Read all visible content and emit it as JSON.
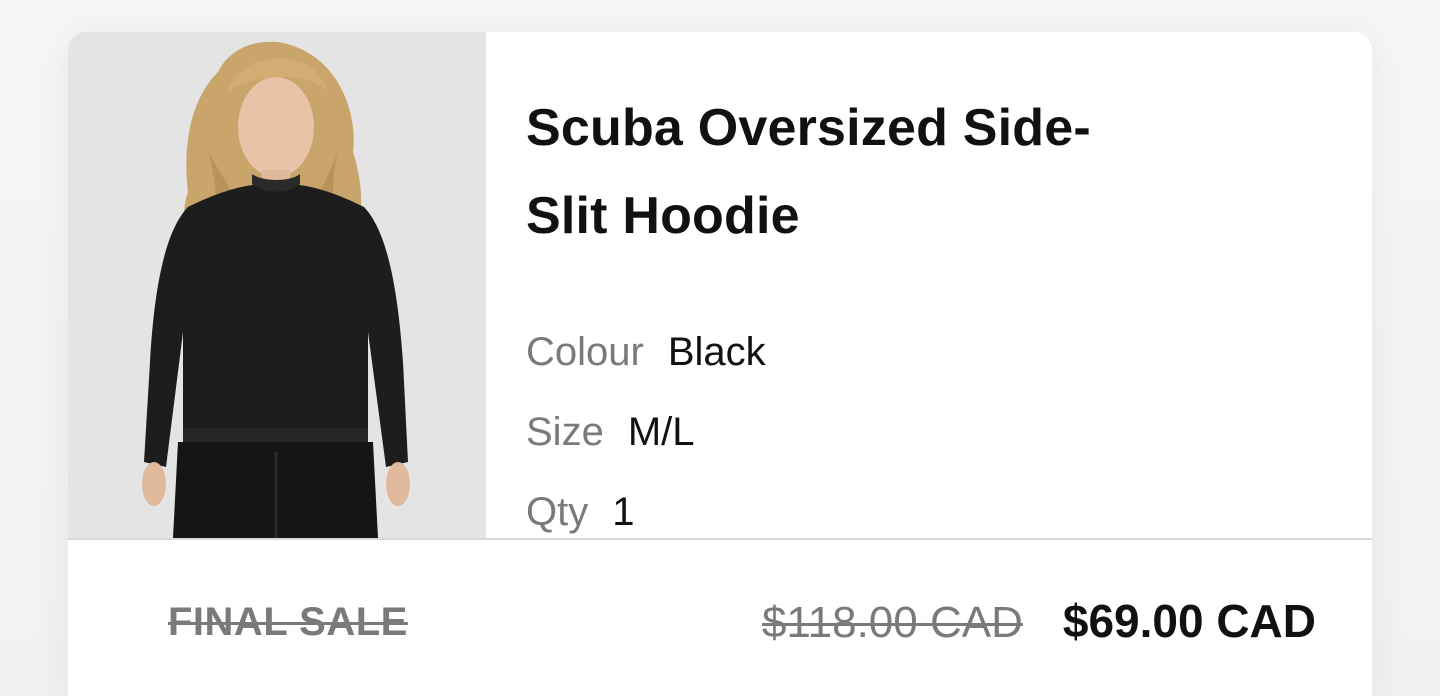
{
  "product": {
    "title": "Scuba Oversized Side-Slit Hoodie",
    "image_alt": "woman wearing black hoodie"
  },
  "attributes": [
    {
      "label": "Colour",
      "value": "Black"
    },
    {
      "label": "Size",
      "value": "M/L"
    },
    {
      "label": "Qty",
      "value": "1"
    }
  ],
  "pricing": {
    "final_sale_label": "FINAL SALE",
    "original_price": "$118.00 CAD",
    "sale_price": "$69.00 CAD"
  },
  "colors": {
    "text_primary": "#111111",
    "text_muted": "#7a7a7a",
    "divider": "#d8d8d8",
    "image_bg": "#e4e4e4"
  }
}
